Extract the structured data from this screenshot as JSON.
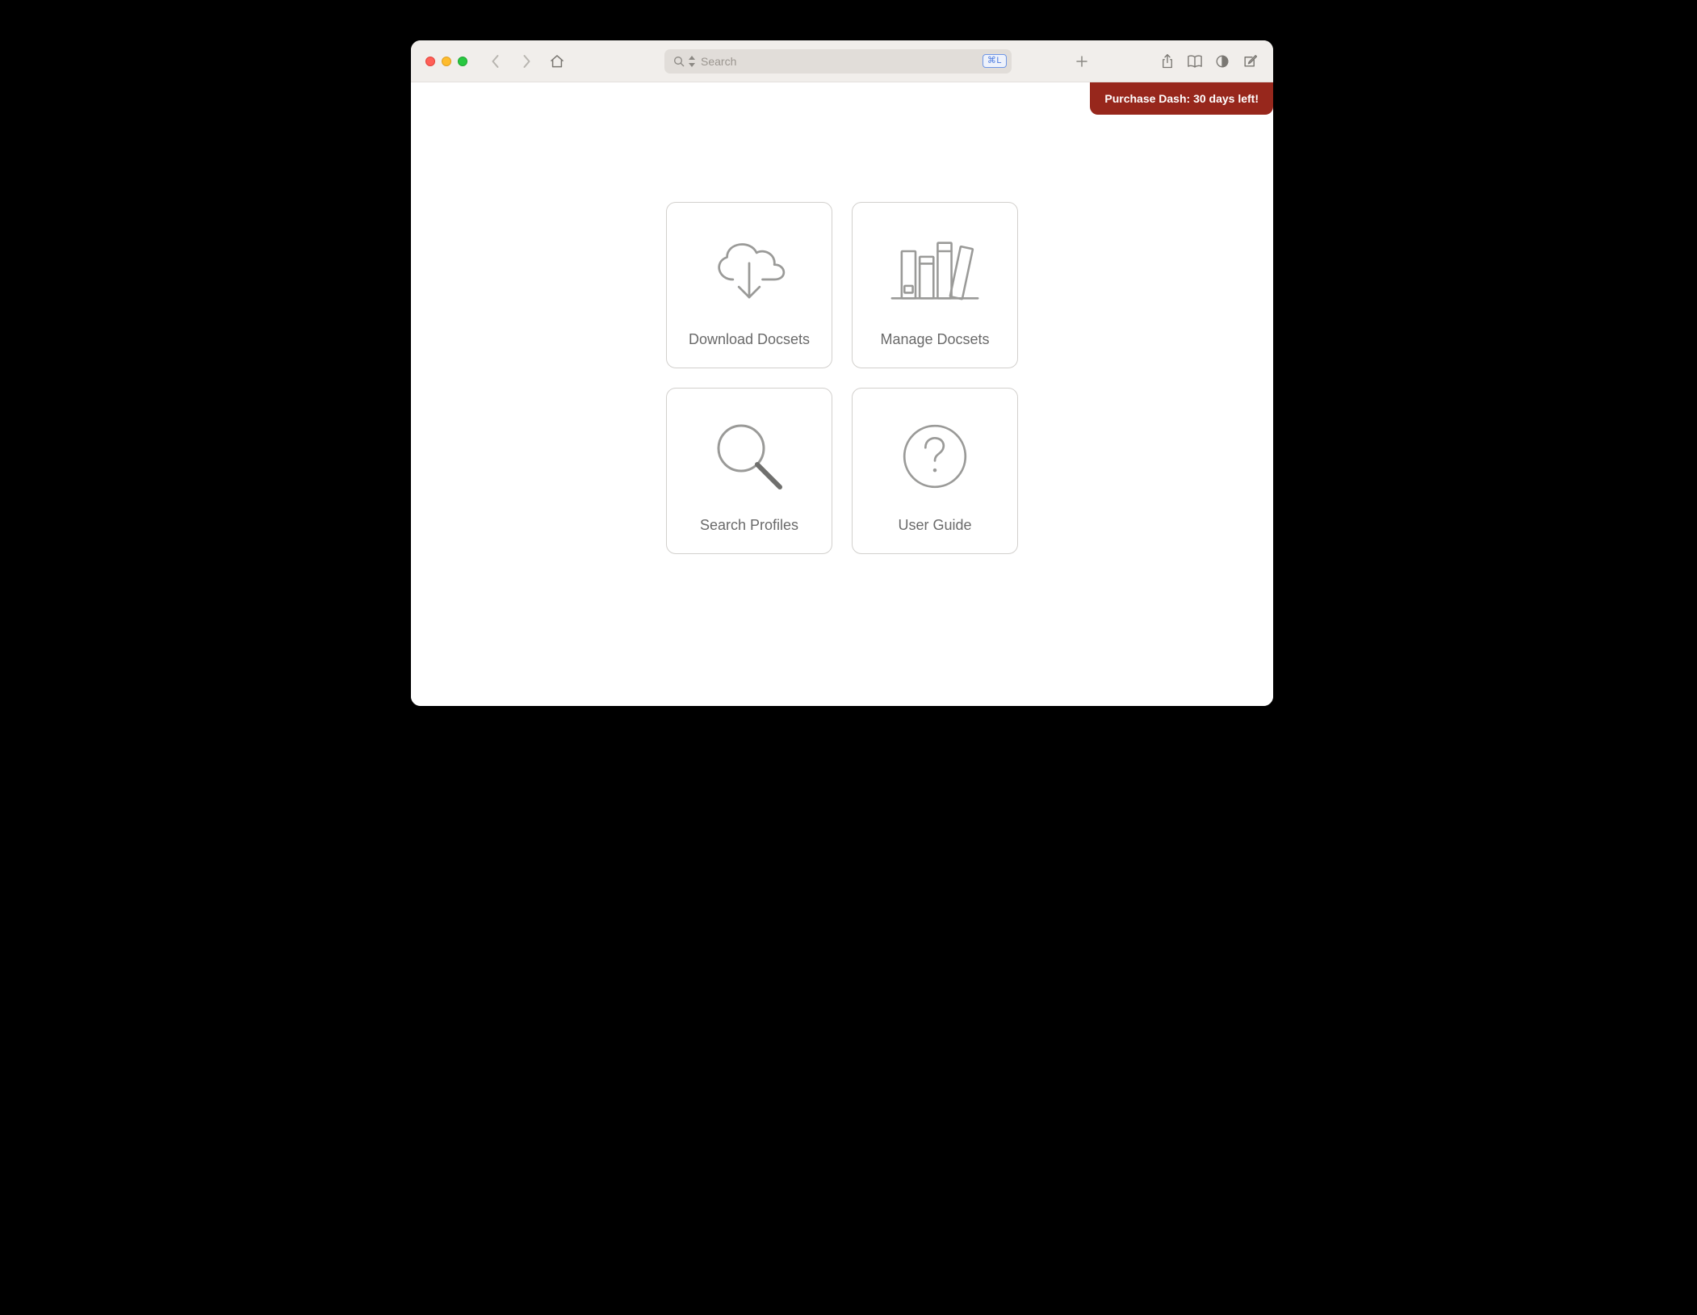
{
  "toolbar": {
    "search_placeholder": "Search",
    "search_shortcut": "⌘L"
  },
  "banner": {
    "text": "Purchase Dash: 30 days left!"
  },
  "cards": {
    "download": "Download Docsets",
    "manage": "Manage Docsets",
    "profiles": "Search Profiles",
    "guide": "User Guide"
  }
}
